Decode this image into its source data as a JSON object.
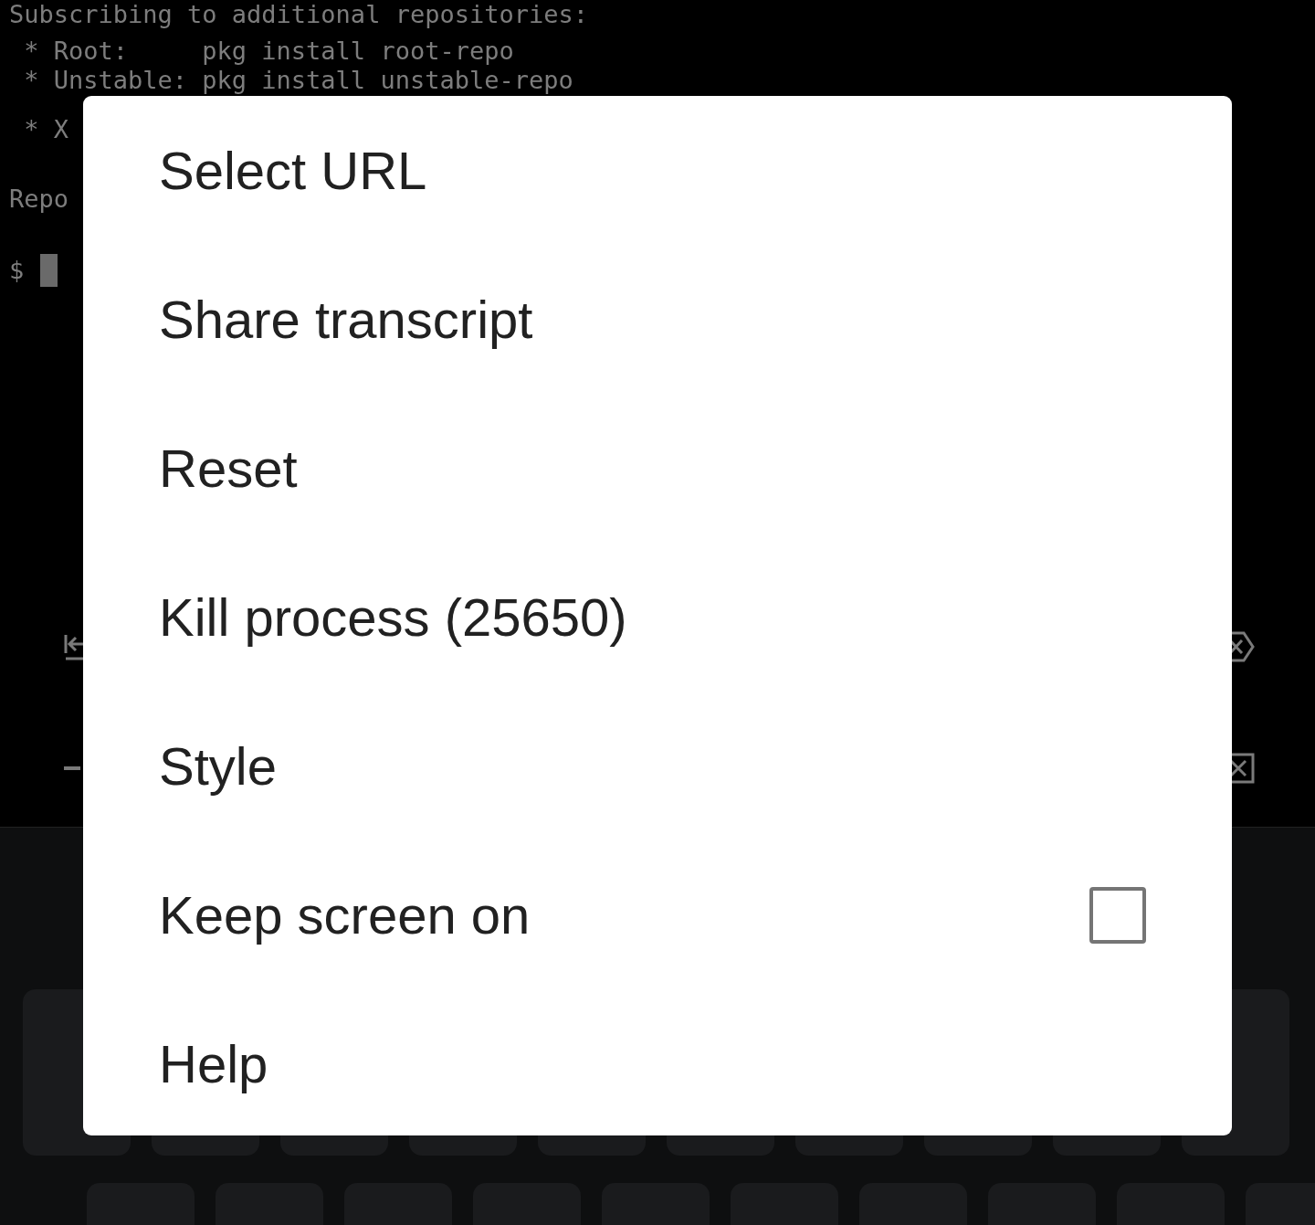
{
  "terminal": {
    "blocks": [
      {
        "lines": [
          "Subscribing to additional repositories:"
        ]
      },
      {
        "lines": [
          " * Root:     pkg install root-repo",
          " * Unstable: pkg install unstable-repo",
          " * X"
        ]
      },
      {
        "lines": [
          "Repo"
        ]
      }
    ],
    "prompt": "$"
  },
  "menu": {
    "items": [
      {
        "kind": "plain",
        "label": "Select URL"
      },
      {
        "kind": "plain",
        "label": "Share transcript"
      },
      {
        "kind": "plain",
        "label": "Reset"
      },
      {
        "kind": "plain",
        "label": "Kill process (25650)"
      },
      {
        "kind": "plain",
        "label": "Style"
      },
      {
        "kind": "checkbox",
        "label": "Keep screen on",
        "checked": false
      },
      {
        "kind": "plain",
        "label": "Help"
      }
    ]
  }
}
